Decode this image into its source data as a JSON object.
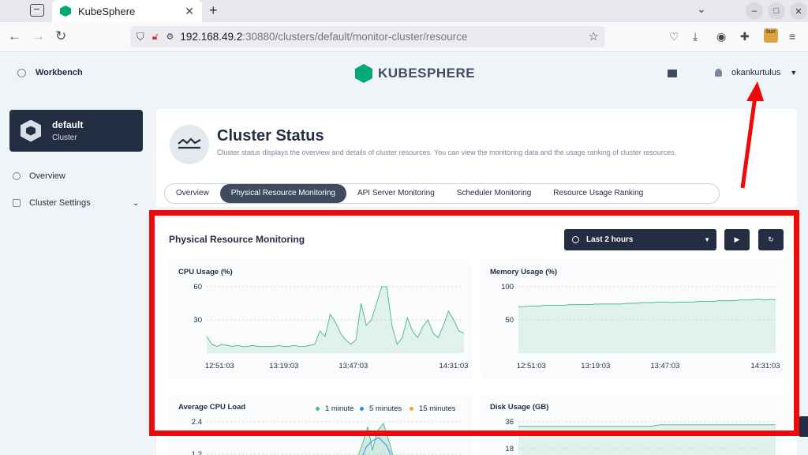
{
  "browser": {
    "tab_title": "KubeSphere",
    "url_host": "192.168.49.2",
    "url_rest": ":30880/clusters/default/monitor-cluster/resource",
    "extension_badge": "buri"
  },
  "topnav": {
    "workbench_label": "Workbench",
    "logo_text": "KUBESPHERE",
    "username": "okankurtulus"
  },
  "sidebar": {
    "cluster_name": "default",
    "cluster_sub": "Cluster",
    "items": [
      {
        "label": "Overview"
      },
      {
        "label": "Cluster Settings"
      }
    ]
  },
  "page": {
    "title": "Cluster Status",
    "description": "Cluster status displays the overview and details of cluster resources. You can view the monitoring data and the usage ranking of cluster resources."
  },
  "tabs": [
    {
      "label": "Overview",
      "active": false
    },
    {
      "label": "Physical Resource Monitoring",
      "active": true
    },
    {
      "label": "API Server Monitoring",
      "active": false
    },
    {
      "label": "Scheduler Monitoring",
      "active": false
    },
    {
      "label": "Resource Usage Ranking",
      "active": false
    }
  ],
  "panel": {
    "title": "Physical Resource Monitoring",
    "time_range": "Last 2 hours"
  },
  "colors": {
    "accent_green": "#55bc8a",
    "dark": "#242e42",
    "annotation_red": "#ee0a0a",
    "series_1min": "#55bc8a",
    "series_5min": "#3385ff",
    "series_15min": "#f5a623"
  },
  "chart_data": [
    {
      "type": "area",
      "title": "CPU Usage (%)",
      "x_ticks": [
        "12:51:03",
        "13:19:03",
        "13:47:03",
        "14:31:03"
      ],
      "y_ticks": [
        60,
        30
      ],
      "ylim": [
        0,
        60
      ],
      "grid": true,
      "values": [
        15,
        8,
        6,
        8,
        7,
        6,
        7,
        6,
        6,
        7,
        6,
        6,
        6,
        6,
        7,
        6,
        6,
        7,
        6,
        6,
        7,
        8,
        20,
        15,
        35,
        28,
        18,
        12,
        8,
        12,
        45,
        25,
        30,
        45,
        60,
        60,
        25,
        8,
        14,
        32,
        20,
        14,
        24,
        30,
        18,
        14,
        25,
        38,
        30,
        20,
        18
      ]
    },
    {
      "type": "area",
      "title": "Memory Usage (%)",
      "x_ticks": [
        "12:51:03",
        "13:19:03",
        "13:47:03",
        "14:31:03"
      ],
      "y_ticks": [
        100,
        50
      ],
      "ylim": [
        0,
        100
      ],
      "grid": true,
      "values": [
        70,
        70,
        71,
        71,
        71,
        72,
        72,
        72,
        72,
        72,
        73,
        73,
        73,
        73,
        73,
        74,
        74,
        74,
        74,
        74,
        74,
        75,
        75,
        75,
        76,
        76,
        76,
        77,
        77,
        77,
        76,
        77,
        77,
        77,
        77,
        78,
        78,
        78,
        78,
        79,
        79,
        79,
        79,
        80,
        80,
        80,
        81,
        81,
        80,
        81,
        80
      ]
    },
    {
      "type": "line",
      "title": "Average CPU Load",
      "y_ticks": [
        2.4,
        1.2
      ],
      "series": [
        {
          "name": "1 minute"
        },
        {
          "name": "5 minutes"
        },
        {
          "name": "15 minutes"
        }
      ]
    },
    {
      "type": "area",
      "title": "Disk Usage (GB)",
      "y_ticks": [
        36,
        18
      ],
      "values": [
        33,
        33,
        33,
        33,
        33,
        33,
        33,
        33,
        33,
        33,
        33,
        33,
        33,
        33,
        33,
        33,
        34,
        34,
        34,
        34,
        34,
        34,
        34,
        34,
        34,
        34,
        34,
        34,
        34,
        34
      ]
    }
  ]
}
